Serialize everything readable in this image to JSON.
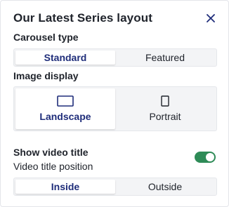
{
  "panel": {
    "title": "Our Latest Series layout",
    "close_icon": "close-icon"
  },
  "carousel_type": {
    "label": "Carousel type",
    "options": [
      "Standard",
      "Featured"
    ],
    "selected": "Standard"
  },
  "image_display": {
    "label": "Image display",
    "options": [
      {
        "label": "Landscape",
        "icon": "landscape-icon"
      },
      {
        "label": "Portrait",
        "icon": "portrait-icon"
      }
    ],
    "selected": "Landscape"
  },
  "video_title": {
    "label": "Show video title",
    "enabled": true,
    "toggle_color": "#2e8b57",
    "position_label": "Video title position",
    "position_options": [
      "Inside",
      "Outside"
    ],
    "position_selected": "Inside"
  },
  "colors": {
    "accent": "#1f2d7a",
    "toggle_on": "#2e8b57"
  }
}
